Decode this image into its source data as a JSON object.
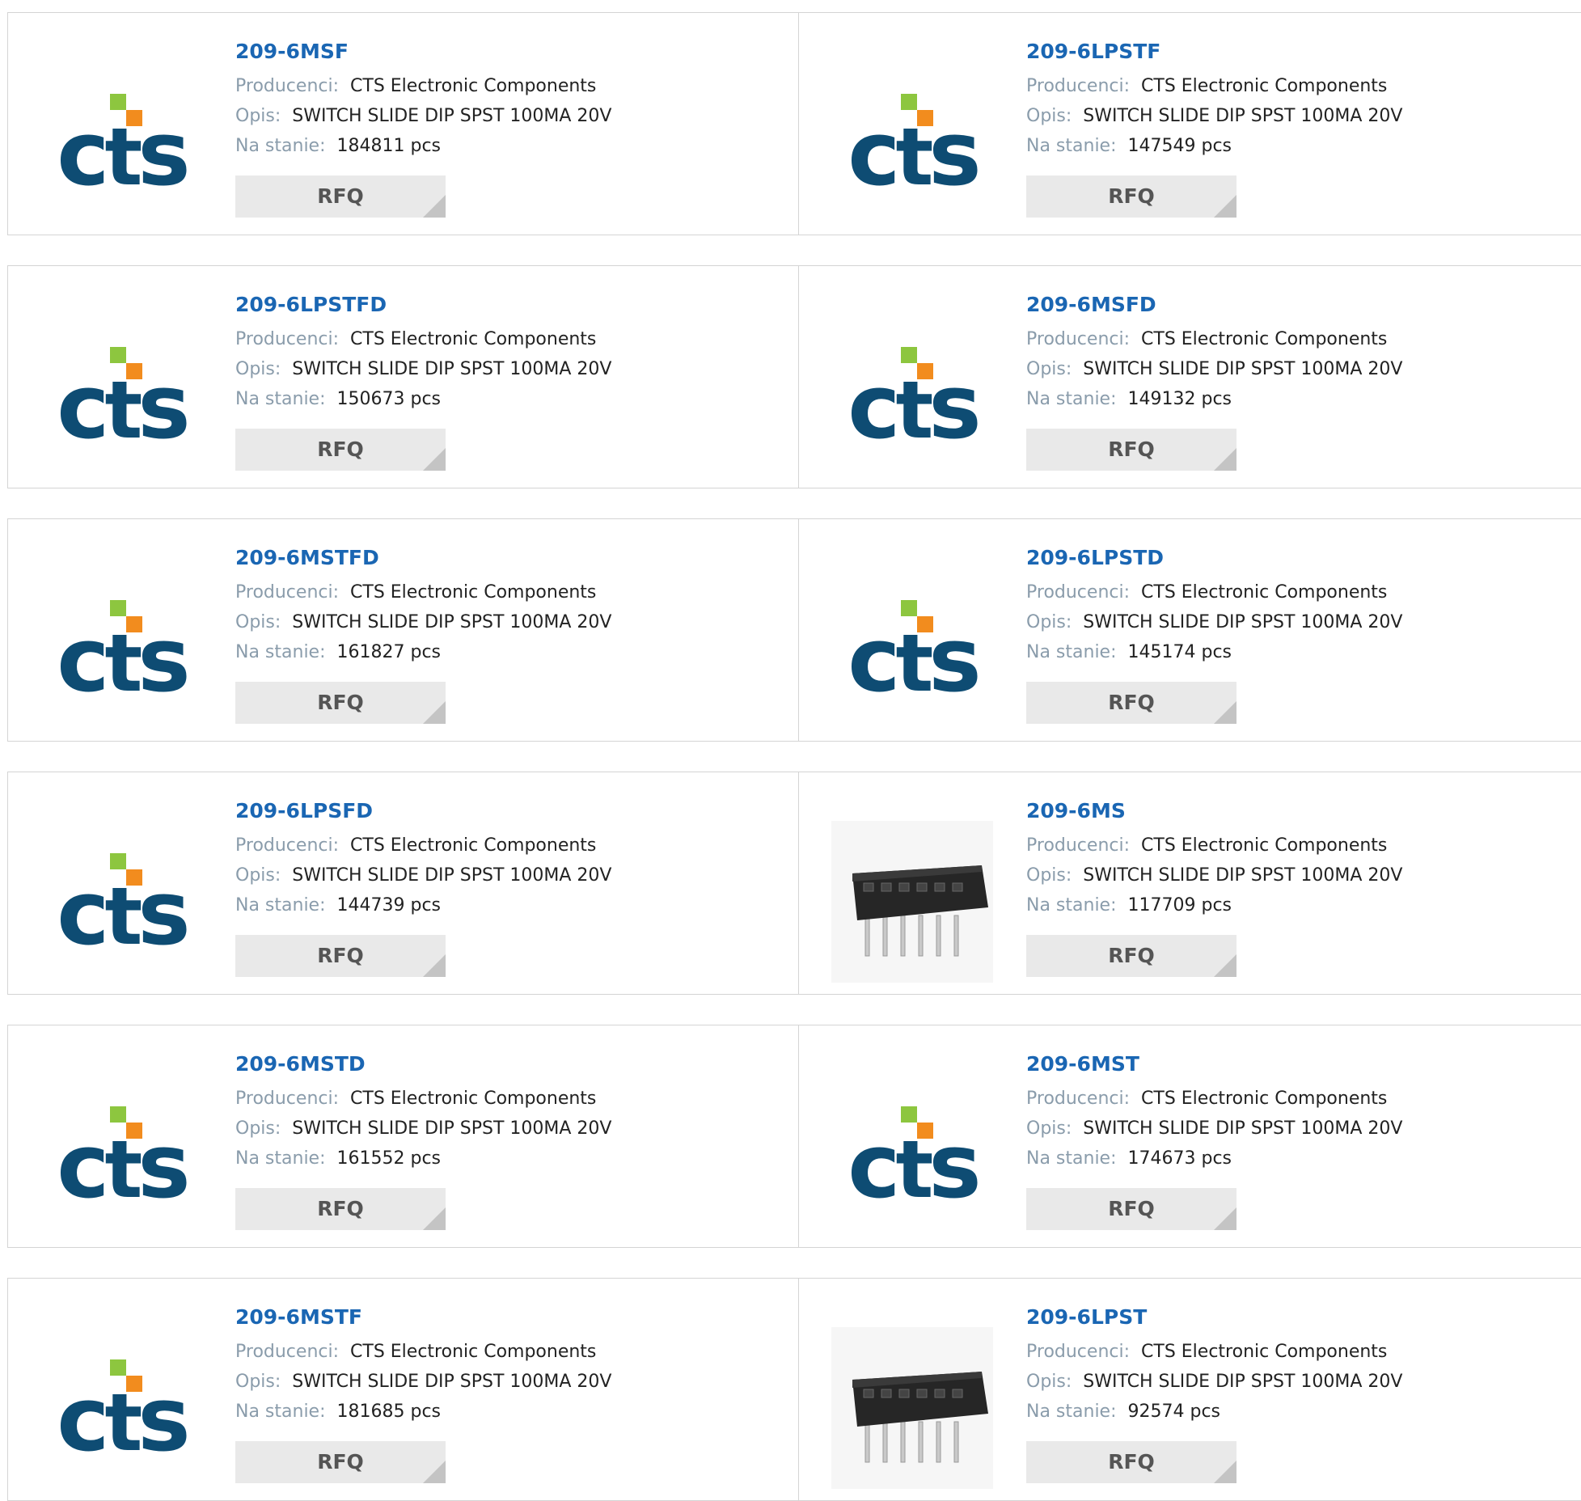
{
  "labels": {
    "manufacturer": "Producenci:",
    "description": "Opis:",
    "stock": "Na stanie:",
    "rfq": "RFQ"
  },
  "colors": {
    "link": "#1a66b3",
    "label": "#8a9cab",
    "cts_blue": "#0e4c73",
    "cts_orange": "#f28c1e",
    "cts_green": "#8dc63f"
  },
  "products": [
    {
      "part": "209-6MSF",
      "manufacturer": "CTS Electronic Components",
      "description": "SWITCH SLIDE DIP SPST 100MA 20V",
      "stock": "184811 pcs",
      "image": "cts-logo"
    },
    {
      "part": "209-6LPSTF",
      "manufacturer": "CTS Electronic Components",
      "description": "SWITCH SLIDE DIP SPST 100MA 20V",
      "stock": "147549 pcs",
      "image": "cts-logo"
    },
    {
      "part": "209-6LPSTFD",
      "manufacturer": "CTS Electronic Components",
      "description": "SWITCH SLIDE DIP SPST 100MA 20V",
      "stock": "150673 pcs",
      "image": "cts-logo"
    },
    {
      "part": "209-6MSFD",
      "manufacturer": "CTS Electronic Components",
      "description": "SWITCH SLIDE DIP SPST 100MA 20V",
      "stock": "149132 pcs",
      "image": "cts-logo"
    },
    {
      "part": "209-6MSTFD",
      "manufacturer": "CTS Electronic Components",
      "description": "SWITCH SLIDE DIP SPST 100MA 20V",
      "stock": "161827 pcs",
      "image": "cts-logo"
    },
    {
      "part": "209-6LPSTD",
      "manufacturer": "CTS Electronic Components",
      "description": "SWITCH SLIDE DIP SPST 100MA 20V",
      "stock": "145174 pcs",
      "image": "cts-logo"
    },
    {
      "part": "209-6LPSFD",
      "manufacturer": "CTS Electronic Components",
      "description": "SWITCH SLIDE DIP SPST 100MA 20V",
      "stock": "144739 pcs",
      "image": "cts-logo"
    },
    {
      "part": "209-6MS",
      "manufacturer": "CTS Electronic Components",
      "description": "SWITCH SLIDE DIP SPST 100MA 20V",
      "stock": "117709 pcs",
      "image": "dip-switch"
    },
    {
      "part": "209-6MSTD",
      "manufacturer": "CTS Electronic Components",
      "description": "SWITCH SLIDE DIP SPST 100MA 20V",
      "stock": "161552 pcs",
      "image": "cts-logo"
    },
    {
      "part": "209-6MST",
      "manufacturer": "CTS Electronic Components",
      "description": "SWITCH SLIDE DIP SPST 100MA 20V",
      "stock": "174673 pcs",
      "image": "cts-logo"
    },
    {
      "part": "209-6MSTF",
      "manufacturer": "CTS Electronic Components",
      "description": "SWITCH SLIDE DIP SPST 100MA 20V",
      "stock": "181685 pcs",
      "image": "cts-logo"
    },
    {
      "part": "209-6LPST",
      "manufacturer": "CTS Electronic Components",
      "description": "SWITCH SLIDE DIP SPST 100MA 20V",
      "stock": "92574 pcs",
      "image": "dip-switch"
    }
  ]
}
